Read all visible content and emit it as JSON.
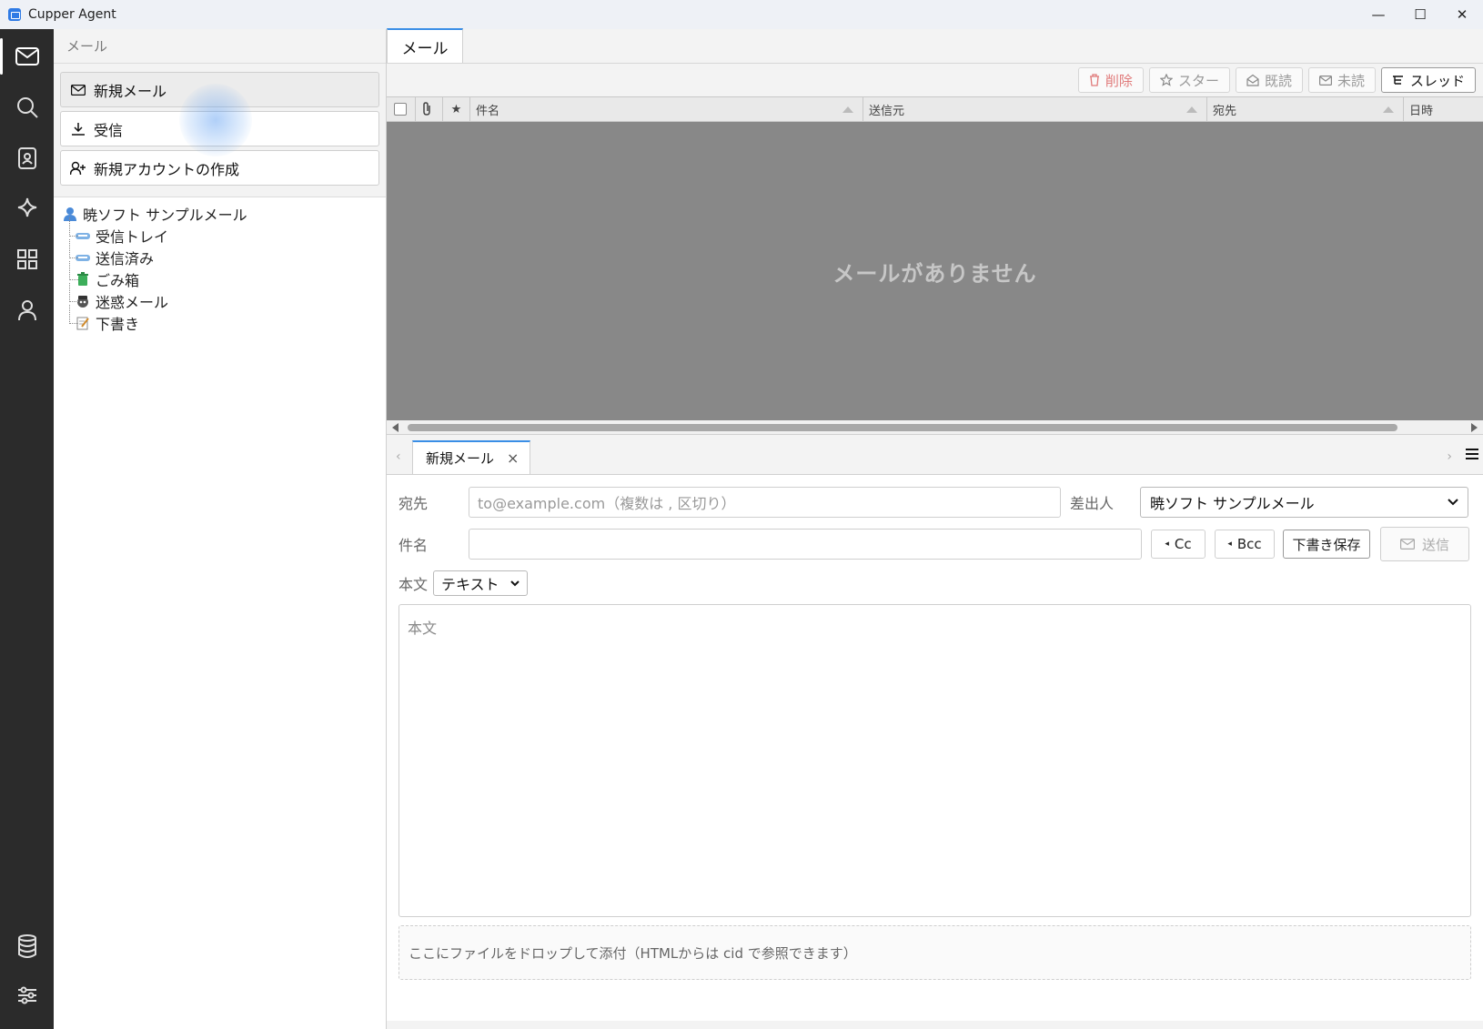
{
  "window": {
    "title": "Cupper Agent",
    "minimize": "—",
    "maximize": "☐",
    "close": "✕"
  },
  "sidebar": {
    "header": "メール",
    "buttons": {
      "new_mail": "新規メール",
      "receive": "受信",
      "new_account": "新規アカウントの作成"
    },
    "account": "暁ソフト サンプルメール",
    "folders": [
      "受信トレイ",
      "送信済み",
      "ごみ箱",
      "迷惑メール",
      "下書き"
    ]
  },
  "main": {
    "tab": "メール",
    "toolbar": {
      "delete": "削除",
      "star": "スター",
      "read": "既読",
      "unread": "未読",
      "thread": "スレッド"
    },
    "columns": {
      "subject": "件名",
      "from": "送信元",
      "to": "宛先",
      "date": "日時"
    },
    "empty": "メールがありません"
  },
  "compose": {
    "tab": "新規メール",
    "to_label": "宛先",
    "to_placeholder": "to@example.com（複数は , 区切り）",
    "from_label": "差出人",
    "from_value": "暁ソフト サンプルメール",
    "subject_label": "件名",
    "cc": "Cc",
    "bcc": "Bcc",
    "save_draft": "下書き保存",
    "send": "送信",
    "body_label": "本文",
    "format": "テキスト",
    "body_placeholder": "本文",
    "drop_hint": "ここにファイルをドロップして添付（HTMLからは cid で参照できます）"
  }
}
